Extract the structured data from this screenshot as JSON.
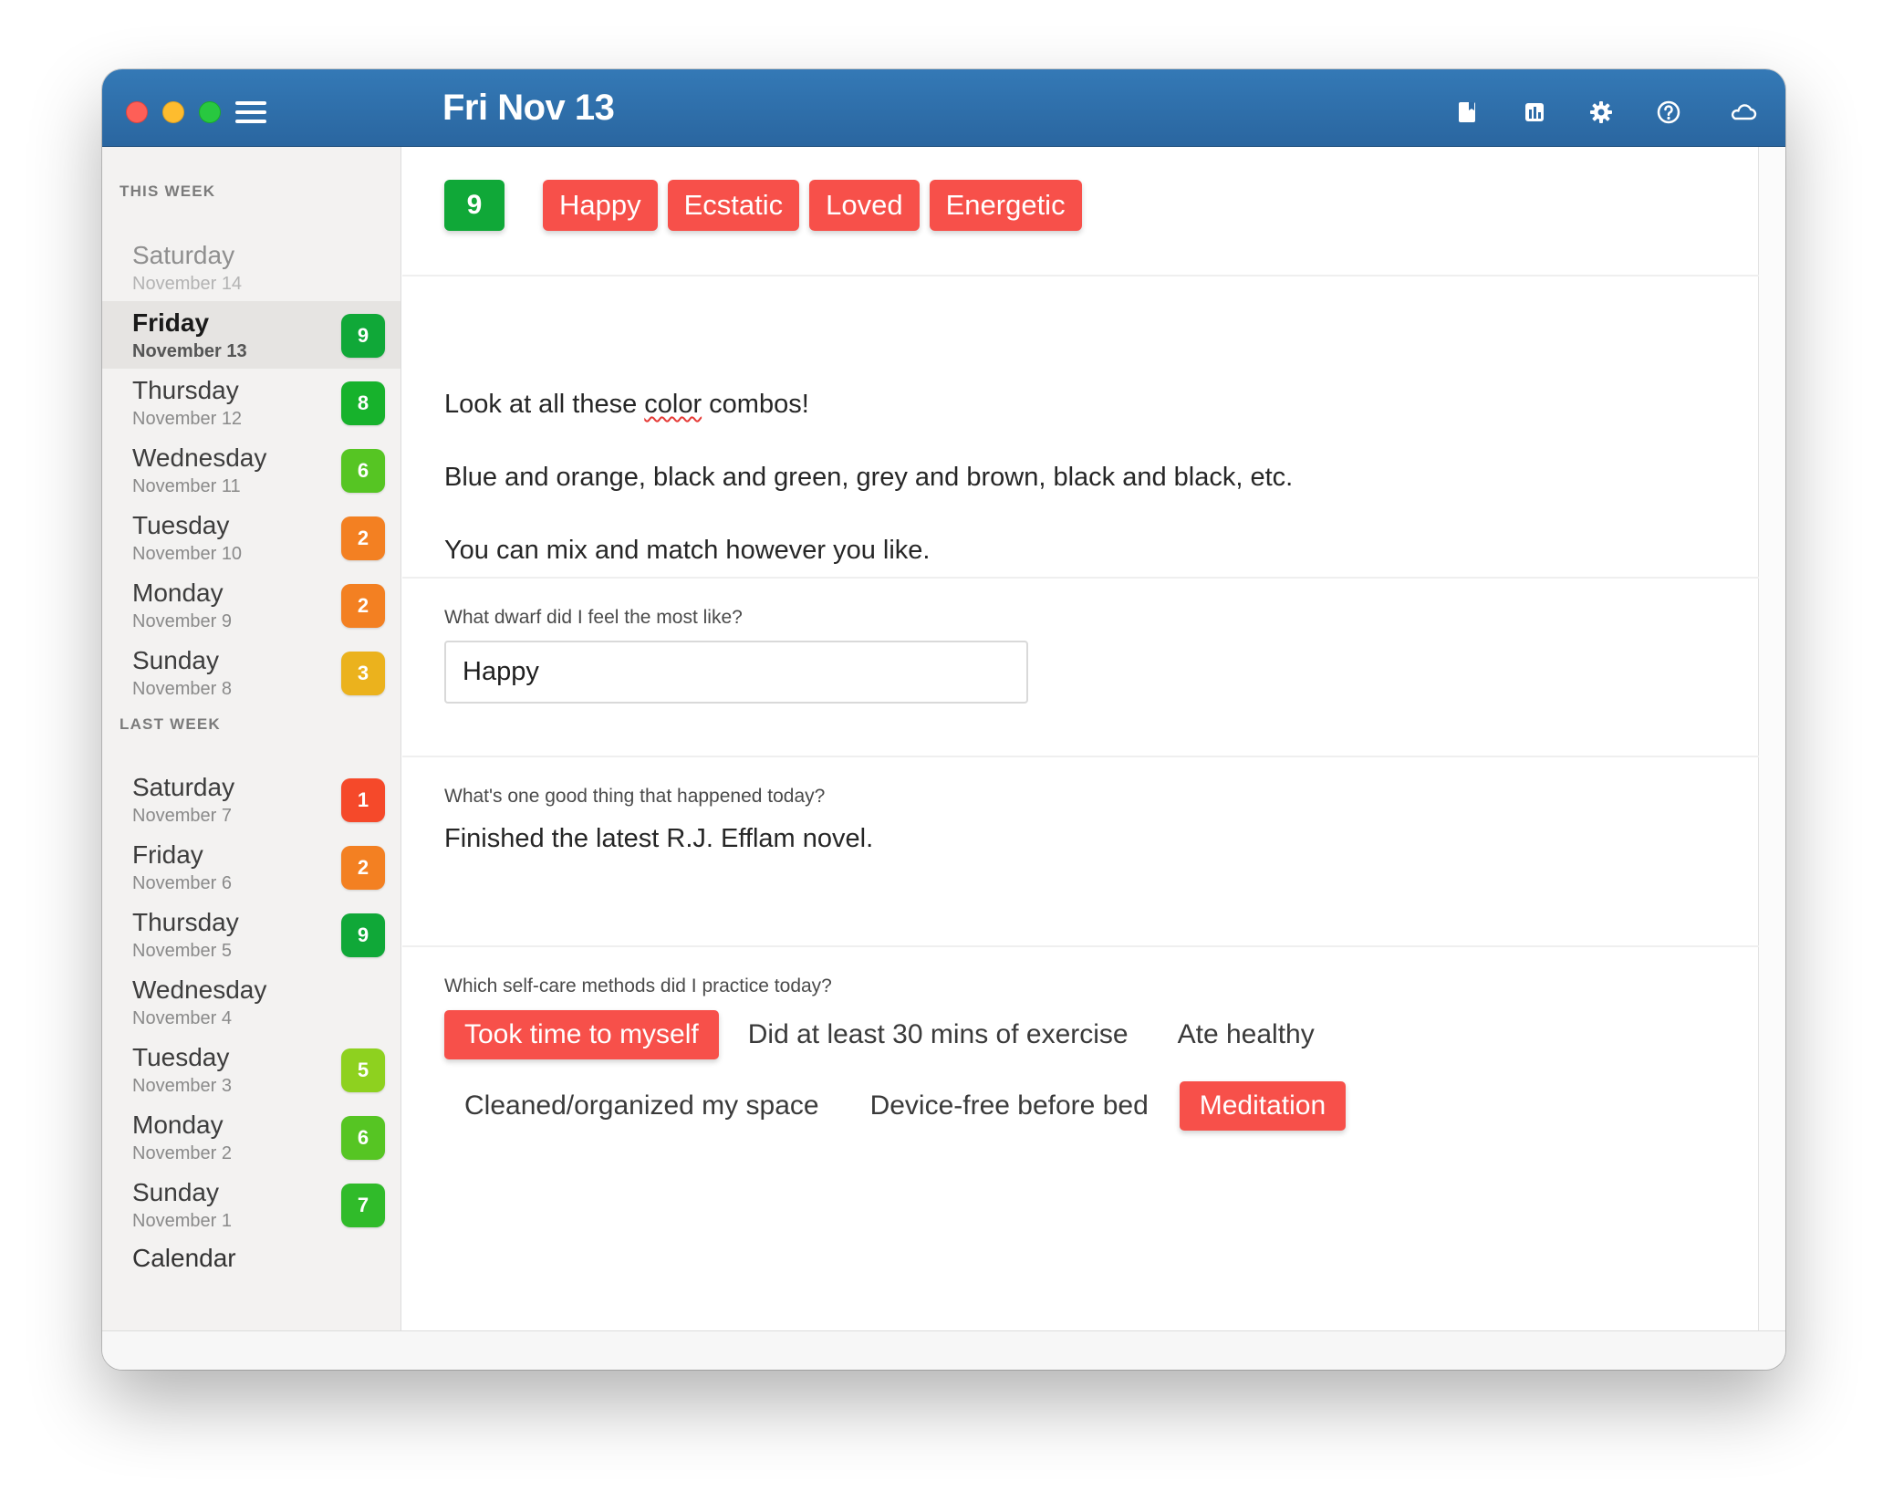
{
  "window": {
    "title": "Fri Nov 13",
    "toolbar_icons": [
      "journal-icon",
      "stats-icon",
      "gear-icon",
      "help-icon",
      "cloud-icon"
    ]
  },
  "sidebar": {
    "sections": [
      {
        "label": "THIS WEEK",
        "days": [
          {
            "name": "Saturday",
            "date": "November 14",
            "score": "",
            "color": "",
            "state": "future"
          },
          {
            "name": "Friday",
            "date": "November 13",
            "score": "9",
            "color": "#10a838",
            "state": "selected"
          },
          {
            "name": "Thursday",
            "date": "November 12",
            "score": "8",
            "color": "#17b22c",
            "state": ""
          },
          {
            "name": "Wednesday",
            "date": "November 11",
            "score": "6",
            "color": "#56c523",
            "state": ""
          },
          {
            "name": "Tuesday",
            "date": "November 10",
            "score": "2",
            "color": "#f38022",
            "state": ""
          },
          {
            "name": "Monday",
            "date": "November 9",
            "score": "2",
            "color": "#f38022",
            "state": ""
          },
          {
            "name": "Sunday",
            "date": "November 8",
            "score": "3",
            "color": "#ebb21d",
            "state": ""
          }
        ]
      },
      {
        "label": "LAST WEEK",
        "days": [
          {
            "name": "Saturday",
            "date": "November 7",
            "score": "1",
            "color": "#f5492a",
            "state": ""
          },
          {
            "name": "Friday",
            "date": "November 6",
            "score": "2",
            "color": "#f38022",
            "state": ""
          },
          {
            "name": "Thursday",
            "date": "November 5",
            "score": "9",
            "color": "#10a838",
            "state": ""
          },
          {
            "name": "Wednesday",
            "date": "November 4",
            "score": "",
            "color": "",
            "state": ""
          },
          {
            "name": "Tuesday",
            "date": "November 3",
            "score": "5",
            "color": "#8ed11f",
            "state": ""
          },
          {
            "name": "Monday",
            "date": "November 2",
            "score": "6",
            "color": "#56c523",
            "state": ""
          },
          {
            "name": "Sunday",
            "date": "November 1",
            "score": "7",
            "color": "#30bb2a",
            "state": ""
          }
        ]
      }
    ],
    "calendar_label": "Calendar"
  },
  "entry": {
    "score": "9",
    "score_color": "#10a838",
    "moods": [
      "Happy",
      "Ecstatic",
      "Loved",
      "Energetic"
    ],
    "note_lines": [
      {
        "before": "Look at all these ",
        "misspelled": "color",
        "after": " combos!"
      },
      {
        "text": "Blue and orange, black and green, grey and brown, black and black, etc."
      },
      {
        "text": "You can mix and match however you like."
      }
    ],
    "q1": {
      "label": "What dwarf did I feel the most like?",
      "value": "Happy"
    },
    "q2": {
      "label": "What's one good thing that happened today?",
      "answer": "Finished the latest R.J. Efflam novel."
    },
    "q3": {
      "label": "Which self-care methods did I practice today?",
      "rows": [
        [
          {
            "text": "Took time to myself",
            "selected": true
          },
          {
            "text": "Did at least 30 mins of exercise",
            "selected": false
          },
          {
            "text": "Ate healthy",
            "selected": false
          }
        ],
        [
          {
            "text": "Cleaned/organized my space",
            "selected": false
          },
          {
            "text": "Device-free before bed",
            "selected": false
          },
          {
            "text": "Meditation",
            "selected": true
          }
        ]
      ]
    }
  }
}
